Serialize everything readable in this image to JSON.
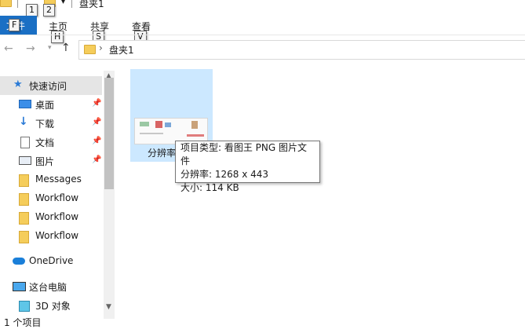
{
  "window": {
    "title": "盘夹1"
  },
  "quick_access_keytips": [
    "1",
    "2"
  ],
  "ribbon": {
    "file_tab": "文件",
    "file_keytip": "F",
    "tabs": [
      {
        "label": "主页",
        "keytip": "H"
      },
      {
        "label": "共享",
        "keytip": "S"
      },
      {
        "label": "查看",
        "keytip": "V"
      }
    ]
  },
  "address": {
    "crumb": "盘夹1"
  },
  "sidebar": {
    "items": [
      {
        "label": "快速访问",
        "icon": "star-icon"
      },
      {
        "label": "桌面",
        "icon": "desktop-icon",
        "pinned": true
      },
      {
        "label": "下载",
        "icon": "download-icon",
        "pinned": true
      },
      {
        "label": "文档",
        "icon": "document-icon",
        "pinned": true
      },
      {
        "label": "图片",
        "icon": "picture-icon",
        "pinned": true
      },
      {
        "label": "Messages",
        "icon": "folder-icon"
      },
      {
        "label": "Workflow",
        "icon": "folder-icon"
      },
      {
        "label": "Workflow",
        "icon": "folder-icon"
      },
      {
        "label": "Workflow",
        "icon": "folder-icon"
      },
      {
        "label": "OneDrive",
        "icon": "cloud-icon"
      },
      {
        "label": "这台电脑",
        "icon": "computer-icon"
      },
      {
        "label": "3D 对象",
        "icon": "3d-objects-icon"
      }
    ]
  },
  "file": {
    "name_visible": "分辨率"
  },
  "tooltip": {
    "line1": "项目类型: 看图王 PNG 图片文件",
    "line2": "分辨率: 1268 x 443",
    "line3": "大小: 114 KB"
  },
  "status": {
    "text": "1 个项目"
  },
  "colors": {
    "accent": "#1a6fc4",
    "selection": "#cce8ff",
    "folder": "#f5cd5b"
  }
}
